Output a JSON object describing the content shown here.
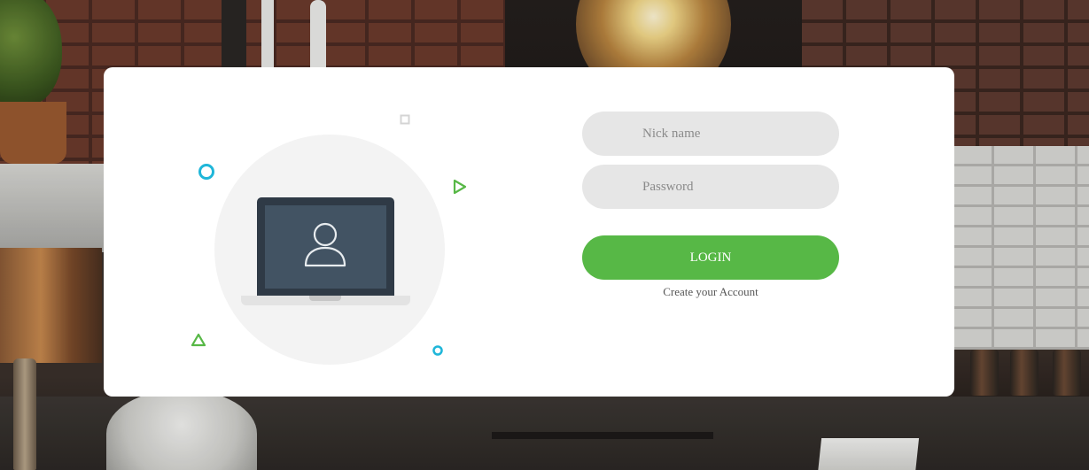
{
  "login_form": {
    "nickname_placeholder": "Nick name",
    "nickname_value": "",
    "password_placeholder": "Password",
    "password_value": "",
    "login_button_label": "LOGIN",
    "create_account_link": "Create your Account"
  },
  "illustration": {
    "icon": "user-icon",
    "device": "laptop-icon"
  },
  "colors": {
    "accent_green": "#57b846",
    "accent_cyan": "#1fb6d9",
    "input_bg": "#e6e6e6",
    "laptop_dark": "#2f3a46"
  }
}
